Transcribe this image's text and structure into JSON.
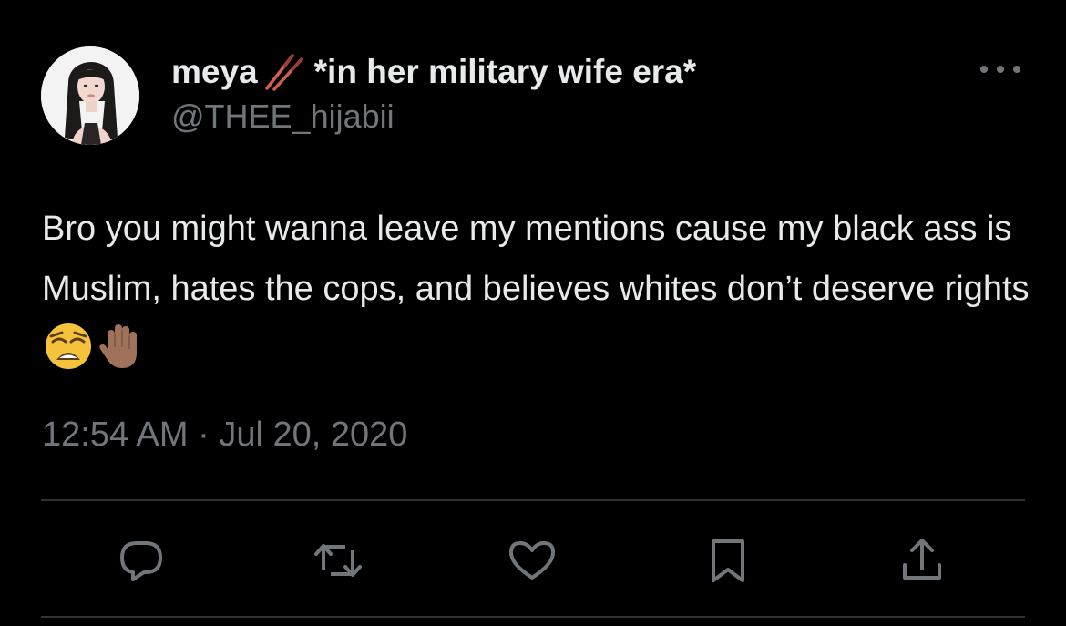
{
  "tweet": {
    "author": {
      "display_name": "meya",
      "name_emoji": "chopsticks",
      "name_suffix": "*in her military wife era*",
      "handle": "@THEE_hijabii"
    },
    "text": "Bro you might wanna leave my mentions cause my black ass is Muslim, hates the cops, and believes whites don’t deserve rights",
    "text_emojis": [
      "weary-face",
      "raised-hand-medium-dark-skin"
    ],
    "timestamp": "12:54 AM · Jul 20, 2020",
    "actions": [
      "reply",
      "retweet",
      "like",
      "bookmark",
      "share"
    ]
  },
  "colors": {
    "background": "#000000",
    "primary_text": "#e7e9ea",
    "secondary_text": "#71767b",
    "divider": "#2f3336"
  }
}
